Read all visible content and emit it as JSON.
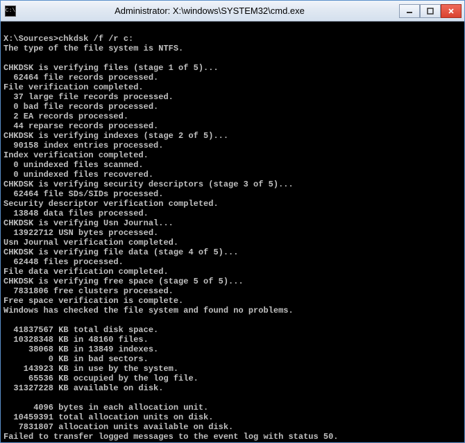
{
  "titlebar": {
    "icon_label": "C:\\",
    "title": "Administrator: X:\\windows\\SYSTEM32\\cmd.exe"
  },
  "prompt": "X:\\Sources>",
  "command": "chkdsk /f /r c:",
  "output": {
    "fs_type_line": "The type of the file system is NTFS.",
    "stage1_header": "CHKDSK is verifying files (stage 1 of 5)...",
    "file_records": "  62464 file records processed.",
    "file_verify_done": "File verification completed.",
    "large_file_records": "  37 large file records processed.",
    "bad_file_records": "  0 bad file records processed.",
    "ea_records": "  2 EA records processed.",
    "reparse_records": "  44 reparse records processed.",
    "stage2_header": "CHKDSK is verifying indexes (stage 2 of 5)...",
    "index_entries": "  90158 index entries processed.",
    "index_verify_done": "Index verification completed.",
    "unindexed_scanned": "  0 unindexed files scanned.",
    "unindexed_recovered": "  0 unindexed files recovered.",
    "stage3_header": "CHKDSK is verifying security descriptors (stage 3 of 5)...",
    "sds_sids": "  62464 file SDs/SIDs processed.",
    "security_done": "Security descriptor verification completed.",
    "data_files": "  13848 data files processed.",
    "usn_header": "CHKDSK is verifying Usn Journal...",
    "usn_bytes": "  13922712 USN bytes processed.",
    "usn_done": "Usn Journal verification completed.",
    "stage4_header": "CHKDSK is verifying file data (stage 4 of 5)...",
    "files_processed": "  62448 files processed.",
    "file_data_done": "File data verification completed.",
    "stage5_header": "CHKDSK is verifying free space (stage 5 of 5)...",
    "free_clusters": "  7831806 free clusters processed.",
    "free_space_done": "Free space verification is complete.",
    "no_problems": "Windows has checked the file system and found no problems.",
    "total_disk": "  41837567 KB total disk space.",
    "in_files": "  10328348 KB in 48160 files.",
    "in_indexes": "     38068 KB in 13849 indexes.",
    "bad_sectors": "         0 KB in bad sectors.",
    "in_use": "    143923 KB in use by the system.",
    "log_file": "     65536 KB occupied by the log file.",
    "available": "  31327228 KB available on disk.",
    "bytes_per_au": "      4096 bytes in each allocation unit.",
    "total_au": "  10459391 total allocation units on disk.",
    "avail_au": "   7831807 allocation units available on disk.",
    "failed_msg": "Failed to transfer logged messages to the event log with status 50."
  }
}
